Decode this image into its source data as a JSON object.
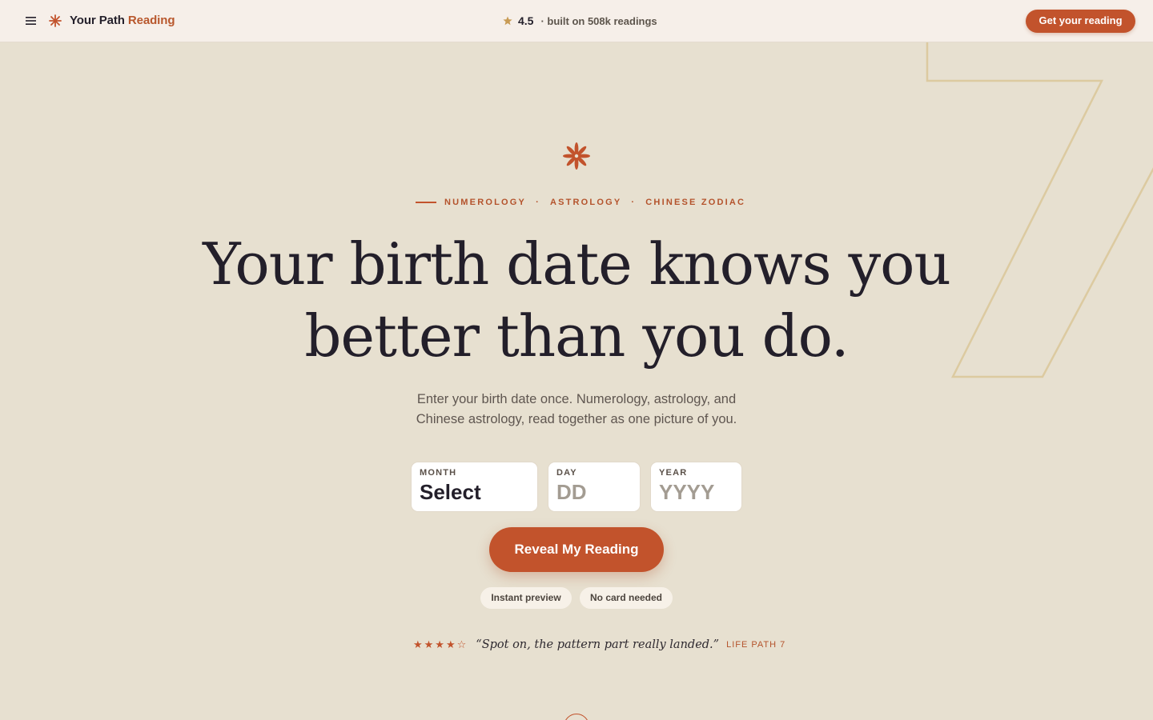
{
  "header": {
    "brand_main": "Your Path",
    "brand_accent": "Reading",
    "rating_score": "4.5",
    "rating_text": "· built on 508k readings",
    "cta_label": "Get your reading"
  },
  "hero": {
    "eyebrow_items": [
      "NUMEROLOGY",
      "ASTROLOGY",
      "CHINESE ZODIAC"
    ],
    "eyebrow_separator": "·",
    "headline_line1": "Your birth date knows you",
    "headline_line2": "better than you do.",
    "subtext_line1": "Enter your birth date once. Numerology, astrology, and",
    "subtext_line2": "Chinese astrology, read together as one picture of you."
  },
  "form": {
    "month_label": "MONTH",
    "month_value": "Select",
    "day_label": "DAY",
    "day_placeholder": "DD",
    "year_label": "YEAR",
    "year_placeholder": "YYYY",
    "submit_label": "Reveal My Reading"
  },
  "chips": [
    "Instant preview",
    "No card needed"
  ],
  "review": {
    "rating": 4,
    "rating_max": 5,
    "stars_text": "★★★★☆",
    "quote": "“Spot on, the pattern part really landed.”",
    "tag": "LIFE PATH 7"
  },
  "colors": {
    "accent": "#c2532c",
    "background": "#e7e0d0",
    "header_background": "#f6efe9",
    "ink": "#231f2a"
  },
  "icons": {
    "menu": "hamburger-menu-icon",
    "brand": "asterisk-star-icon",
    "rating": "star-icon",
    "hero": "asterisk-star-icon"
  }
}
